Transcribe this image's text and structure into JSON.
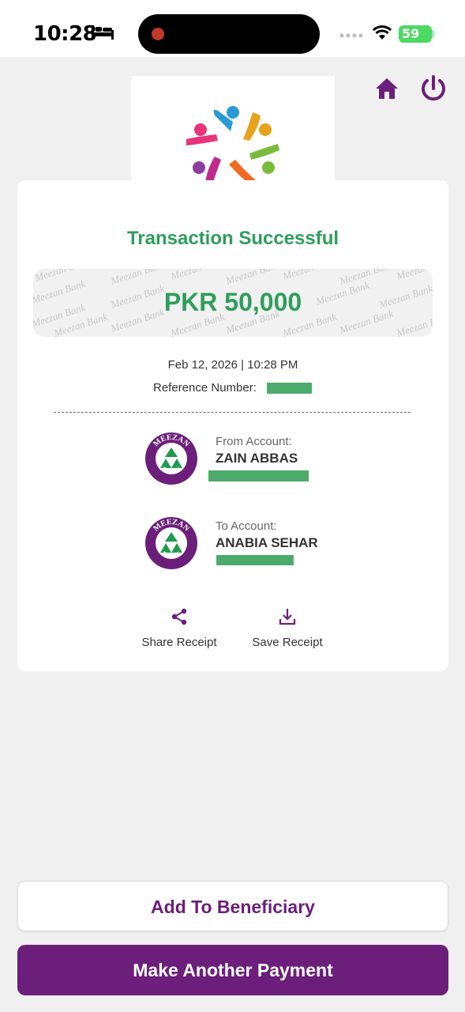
{
  "status_bar": {
    "time": "10:28",
    "battery": "59",
    "icons": [
      "bed-icon",
      "signal-icon",
      "wifi-icon",
      "battery-icon"
    ]
  },
  "header": {
    "icons": [
      "home-icon",
      "power-icon",
      "app-logo"
    ]
  },
  "receipt": {
    "title": "Transaction Successful",
    "amount": "PKR 50,000",
    "watermark_text": "Meezan Bank",
    "datetime": "Feb 12, 2026 | 10:28 PM",
    "reference_label": "Reference Number:",
    "from": {
      "label": "From Account:",
      "name": "ZAIN ABBAS",
      "bank_logo_text": [
        "MEEZAN",
        "BANK"
      ]
    },
    "to": {
      "label": "To Account:",
      "name": "ANABIA SEHAR",
      "bank_logo_text": [
        "MEEZAN",
        "BANK"
      ]
    },
    "actions": {
      "share": "Share Receipt",
      "save": "Save Receipt"
    }
  },
  "buttons": {
    "add_beneficiary": "Add To Beneficiary",
    "make_payment": "Make Another Payment"
  },
  "colors": {
    "brand_purple": "#6b1f7a",
    "success_green": "#2e9e5b",
    "redaction_green": "#4caa6c",
    "background": "#f0f0f0"
  }
}
